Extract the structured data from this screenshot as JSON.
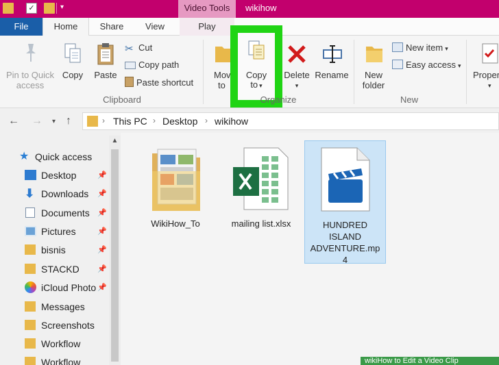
{
  "titlebar": {
    "contextual_tab": "Video Tools",
    "window_title": "wikihow",
    "accent_color": "#c2006d"
  },
  "tabs": [
    {
      "label": "File"
    },
    {
      "label": "Home"
    },
    {
      "label": "Share"
    },
    {
      "label": "View"
    },
    {
      "label": "Play"
    }
  ],
  "ribbon": {
    "clipboard": {
      "pin_label_1": "Pin to Quick",
      "pin_label_2": "access",
      "copy": "Copy",
      "paste": "Paste",
      "cut": "Cut",
      "copy_path": "Copy path",
      "paste_shortcut": "Paste shortcut",
      "group": "Clipboard"
    },
    "organize": {
      "move_1": "Move",
      "move_2": "to",
      "copy_1": "Copy",
      "copy_2": "to",
      "delete": "Delete",
      "rename": "Rename",
      "group": "Organize"
    },
    "new": {
      "folder_1": "New",
      "folder_2": "folder",
      "new_item": "New item",
      "easy_access": "Easy access",
      "group": "New"
    },
    "open": {
      "properties": "Proper"
    },
    "highlight_color": "#20d414"
  },
  "address": {
    "crumbs": [
      "This PC",
      "Desktop",
      "wikihow"
    ]
  },
  "nav": {
    "items": [
      {
        "label": "Quick access",
        "icon": "star-icon"
      },
      {
        "label": "Desktop",
        "icon": "desktop-icon",
        "pinned": true
      },
      {
        "label": "Downloads",
        "icon": "download-icon",
        "pinned": true
      },
      {
        "label": "Documents",
        "icon": "documents-icon",
        "pinned": true
      },
      {
        "label": "Pictures",
        "icon": "pictures-icon",
        "pinned": true
      },
      {
        "label": "bisnis",
        "icon": "folder-icon",
        "pinned": true
      },
      {
        "label": "STACKD",
        "icon": "folder-icon",
        "pinned": true
      },
      {
        "label": "iCloud Photo",
        "icon": "icloud-photos-icon",
        "pinned": true
      },
      {
        "label": "Messages",
        "icon": "folder-icon"
      },
      {
        "label": "Screenshots",
        "icon": "folder-icon"
      },
      {
        "label": "Workflow",
        "icon": "folder-icon"
      },
      {
        "label": "Workflow",
        "icon": "folder-icon"
      }
    ]
  },
  "files": [
    {
      "name": "WikiHow_To",
      "icon": "folder-icon"
    },
    {
      "name": "mailing list.xlsx",
      "icon": "excel-file-icon"
    },
    {
      "name_lines": [
        "HUNDRED",
        "ISLAND",
        "ADVENTURE.mp",
        "4"
      ],
      "icon": "video-file-icon",
      "selected": true
    }
  ],
  "watermark": "wikiHow to Edit a Video Clip"
}
